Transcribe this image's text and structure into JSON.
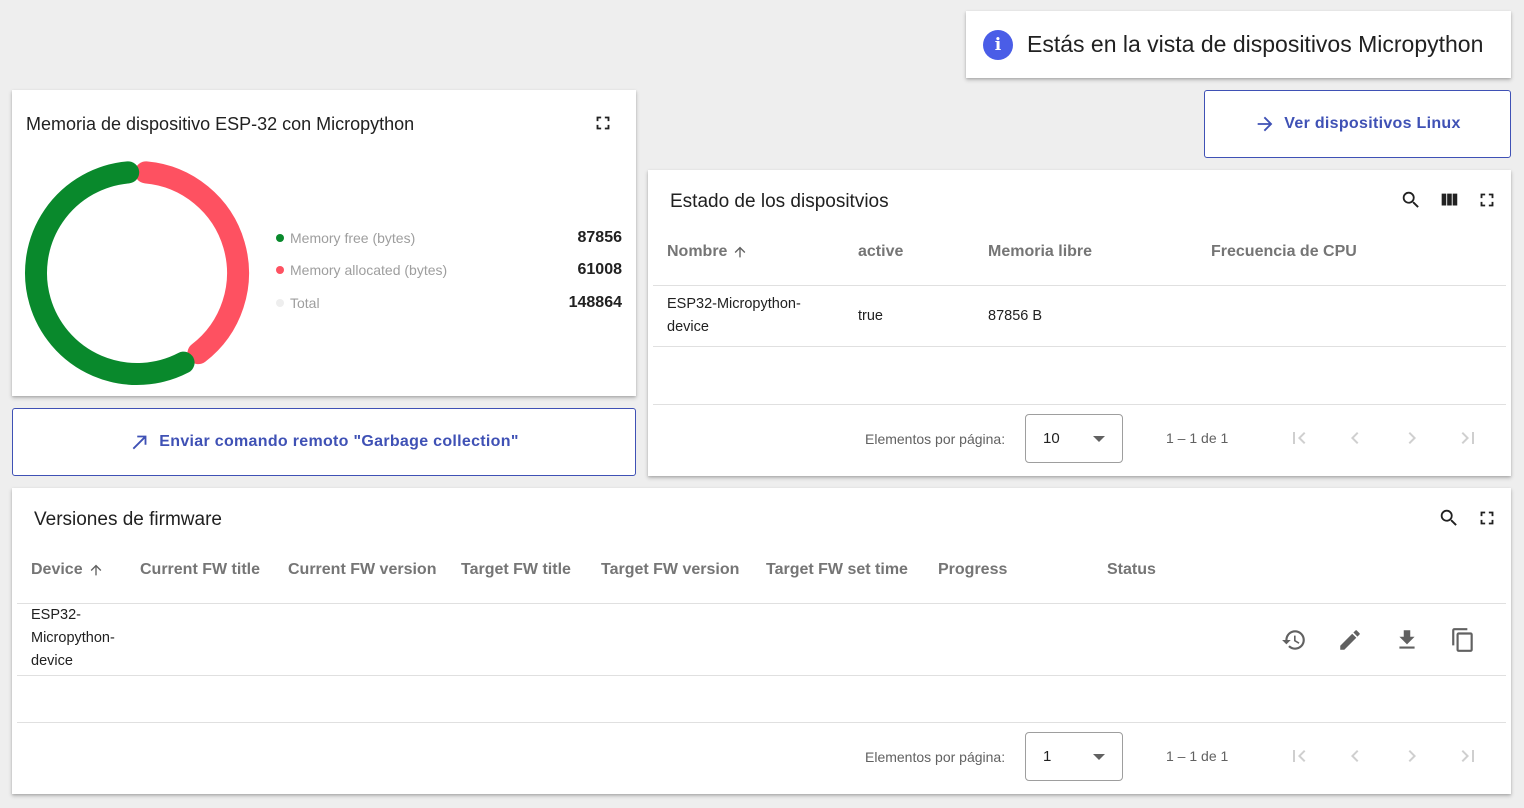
{
  "info_toast": {
    "text": "Estás en la vista de dispositivos Micropython",
    "icon": "info-icon"
  },
  "linux_button": {
    "label": "Ver dispositivos Linux",
    "icon": "arrow-right-icon"
  },
  "gc_button": {
    "label": "Enviar comando remoto \"Garbage collection\"",
    "icon": "arrow-up-right-icon"
  },
  "memory_card": {
    "title": "Memoria de dispositivo ESP-32 con Micropython",
    "legend": [
      {
        "label": "Memory free (bytes)",
        "value": "87856",
        "color": "#09892c"
      },
      {
        "label": "Memory allocated (bytes)",
        "value": "61008",
        "color": "#fe5161"
      },
      {
        "label": "Total",
        "value": "148864",
        "color": "#eeeeee"
      }
    ]
  },
  "chart_data": {
    "type": "pie",
    "title": "Memoria de dispositivo ESP-32 con Micropython",
    "categories": [
      "Memory free (bytes)",
      "Memory allocated (bytes)"
    ],
    "values": [
      87856,
      61008
    ],
    "colors": [
      "#09892c",
      "#fe5161"
    ],
    "total": 148864
  },
  "devices_card": {
    "title": "Estado de los dispositvios",
    "columns": [
      "Nombre",
      "active",
      "Memoria libre",
      "Frecuencia de CPU"
    ],
    "rows": [
      {
        "name_line1": "ESP32-Micropython-",
        "name_line2": "device",
        "active": "true",
        "free_memory": "87856 B",
        "cpu_freq": ""
      }
    ],
    "paginator": {
      "label": "Elementos por página:",
      "page_size": "10",
      "range": "1 – 1 de 1"
    }
  },
  "firmware_card": {
    "title": "Versiones de firmware",
    "columns": [
      "Device",
      "Current FW title",
      "Current FW version",
      "Target FW title",
      "Target FW version",
      "Target FW set time",
      "Progress",
      "Status"
    ],
    "rows": [
      {
        "device_line1": "ESP32-",
        "device_line2": "Micropython-",
        "device_line3": "device"
      }
    ],
    "paginator": {
      "label": "Elementos por página:",
      "page_size": "1",
      "range": "1 – 1 de 1"
    }
  }
}
